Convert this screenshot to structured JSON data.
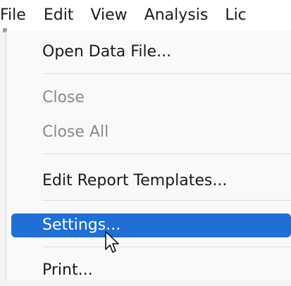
{
  "menubar": {
    "items": [
      {
        "label": "File"
      },
      {
        "label": "Edit"
      },
      {
        "label": "View"
      },
      {
        "label": "Analysis"
      },
      {
        "label": "Lic"
      }
    ]
  },
  "file_menu": {
    "open_data_file": "Open Data File...",
    "close": "Close",
    "close_all": "Close All",
    "edit_report_templates": "Edit Report Templates...",
    "settings": "Settings...",
    "print": "Print..."
  },
  "colors": {
    "highlight": "#1f6fd6",
    "disabled_text": "#8a8a8a"
  },
  "cursor": {
    "icon": "arrow-pointer-icon"
  }
}
